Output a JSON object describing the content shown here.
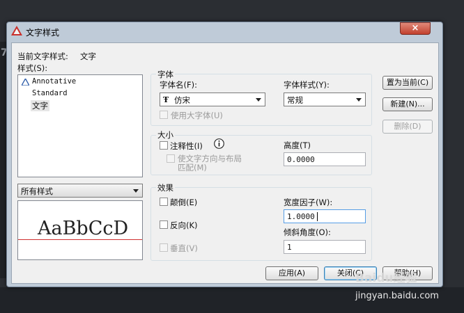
{
  "window": {
    "title": "文字样式",
    "close_glyph": "×"
  },
  "current_style": {
    "label": "当前文字样式:",
    "value": "文字"
  },
  "styles": {
    "label": "样式(S):",
    "items": [
      {
        "name": "Annotative",
        "icon": "annotative-icon"
      },
      {
        "name": "Standard"
      },
      {
        "name": "文字"
      }
    ],
    "selected": "文字"
  },
  "filter": {
    "value": "所有样式"
  },
  "preview": {
    "text": "AaBbCcD"
  },
  "font": {
    "group_title": "字体",
    "font_name_label": "字体名(F):",
    "font_name_value": "仿宋",
    "font_icon": "truetype-icon",
    "font_style_label": "字体样式(Y):",
    "font_style_value": "常规",
    "bigfont_label": "使用大字体(U)"
  },
  "size": {
    "group_title": "大小",
    "annotative_label": "注释性(I)",
    "orient_label_line1": "使文字方向与布局",
    "orient_label_line2": "匹配(M)",
    "height_label": "高度(T)",
    "height_value": "0.0000"
  },
  "effects": {
    "group_title": "效果",
    "upside_down_label": "颠倒(E)",
    "backwards_label": "反向(K)",
    "vertical_label": "垂直(V)",
    "width_factor_label": "宽度因子(W):",
    "width_factor_value": "1.0000",
    "oblique_label": "倾斜角度(O):",
    "oblique_value": "1"
  },
  "buttons": {
    "set_current": "置为当前(C)",
    "new": "新建(N)...",
    "delete": "删除(D)",
    "apply": "应用(A)",
    "close": "关闭(C)",
    "help": "帮助(H)"
  },
  "watermark": {
    "brand": "Baidu经验",
    "url": "jingyan.baidu.com"
  }
}
